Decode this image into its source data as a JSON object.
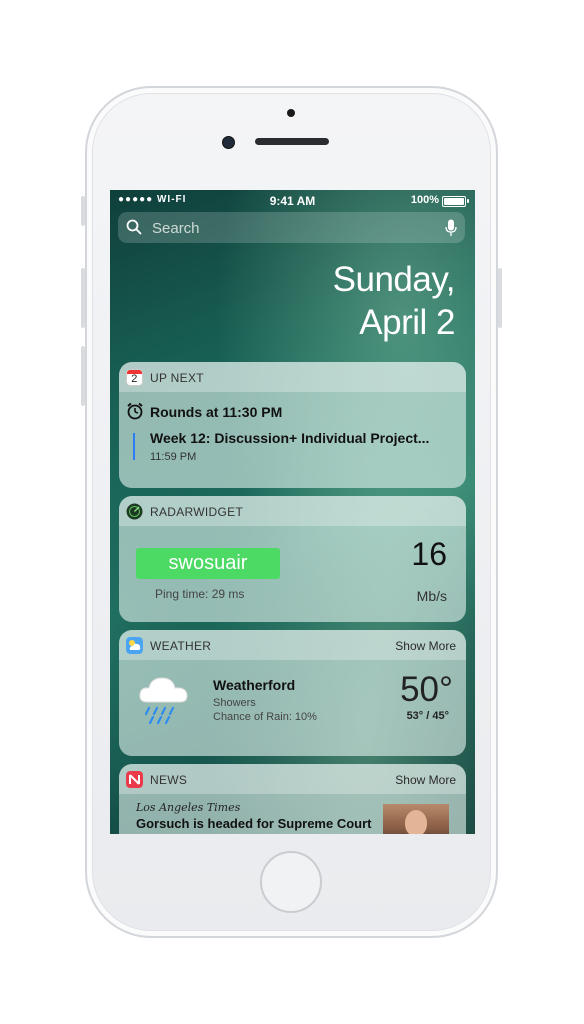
{
  "status_bar": {
    "carrier": "●●●●● WI-FI",
    "time": "9:41 AM",
    "battery": "100%",
    "battery_level": 1.0
  },
  "search": {
    "placeholder": "Search"
  },
  "date": {
    "line1": "Sunday,",
    "line2": "April 2"
  },
  "up_next": {
    "header": "UP NEXT",
    "icon_day": "2",
    "event1": "Rounds at 11:30 PM",
    "event2": "Week 12: Discussion+ Individual Project...",
    "event2_time": "11:59 PM"
  },
  "radar": {
    "header": "RADARWIDGET",
    "network": "swosuair",
    "ping": "Ping time: 29 ms",
    "speed": "16",
    "unit": "Mb/s"
  },
  "weather": {
    "header": "WEATHER",
    "show_more": "Show More",
    "city": "Weatherford",
    "condition": "Showers",
    "rain": "Chance of Rain: 10%",
    "temp": "50°",
    "hilo": "53° / 45°"
  },
  "news": {
    "header": "NEWS",
    "show_more": "Show More",
    "publication": "Los Angeles Times",
    "headline": "Gorsuch is headed for Supreme Court"
  },
  "colors": {
    "accent_green": "#4cd964",
    "event_bar": "#2d7cf6",
    "news_red": "#e9394b"
  }
}
